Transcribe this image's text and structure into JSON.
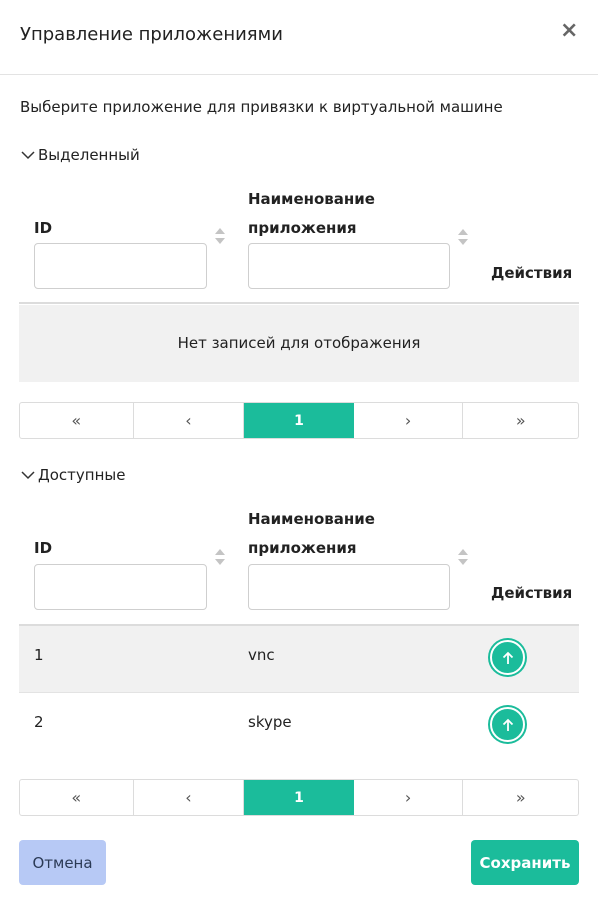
{
  "dialog": {
    "title": "Управление приложениями",
    "close_glyph": "×",
    "intro": "Выберите приложение для привязки к виртуальной машине"
  },
  "selected": {
    "title": "Выделенный",
    "columns": {
      "id": "ID",
      "name_line1": "Наименование",
      "name_line2": "приложения",
      "actions": "Действия"
    },
    "empty_text": "Нет записей для отображения",
    "pager": {
      "first": "«",
      "prev": "‹",
      "page": "1",
      "next": "›",
      "last": "»"
    }
  },
  "available": {
    "title": "Доступные",
    "columns": {
      "id": "ID",
      "name_line1": "Наименование",
      "name_line2": "приложения",
      "actions": "Действия"
    },
    "rows": [
      {
        "id": "1",
        "name": "vnc",
        "action_icon": "arrow-up-circle-icon"
      },
      {
        "id": "2",
        "name": "skype",
        "action_icon": "arrow-up-circle-icon"
      }
    ],
    "pager": {
      "first": "«",
      "prev": "‹",
      "page": "1",
      "next": "›",
      "last": "»"
    }
  },
  "footer": {
    "cancel_label": "Отмена",
    "save_label": "Сохранить"
  },
  "colors": {
    "accent": "#1bbc9b",
    "cancel_bg": "#b7c9f5",
    "empty_bg": "#f1f1f1"
  }
}
